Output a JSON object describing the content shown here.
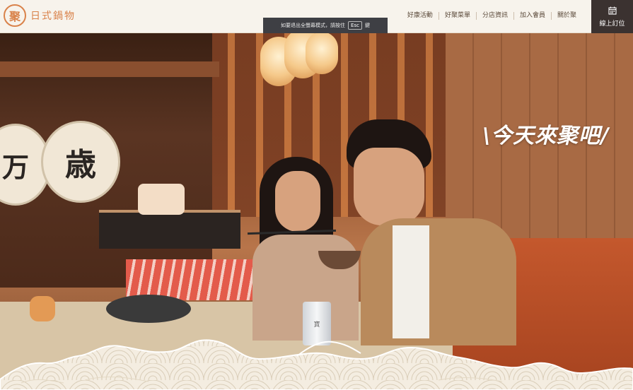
{
  "brand": {
    "mark": "聚",
    "name": "日式鍋物",
    "accent": "#d9824a"
  },
  "nav": {
    "items": [
      {
        "label": "好康活動"
      },
      {
        "label": "好聚菜單"
      },
      {
        "label": "分店資訊"
      },
      {
        "label": "加入會員"
      },
      {
        "label": "關於聚"
      }
    ]
  },
  "booking": {
    "icon": "calendar-icon",
    "label": "線上訂位",
    "background": "#3b3230"
  },
  "toast": {
    "prefix": "如要退出全螢幕模式，請按住",
    "key": "Esc",
    "suffix": "鍵"
  },
  "hero": {
    "tagline": "\\今天來聚吧/",
    "sign_left": "万",
    "sign_right": "歳",
    "can_text": "寶"
  }
}
